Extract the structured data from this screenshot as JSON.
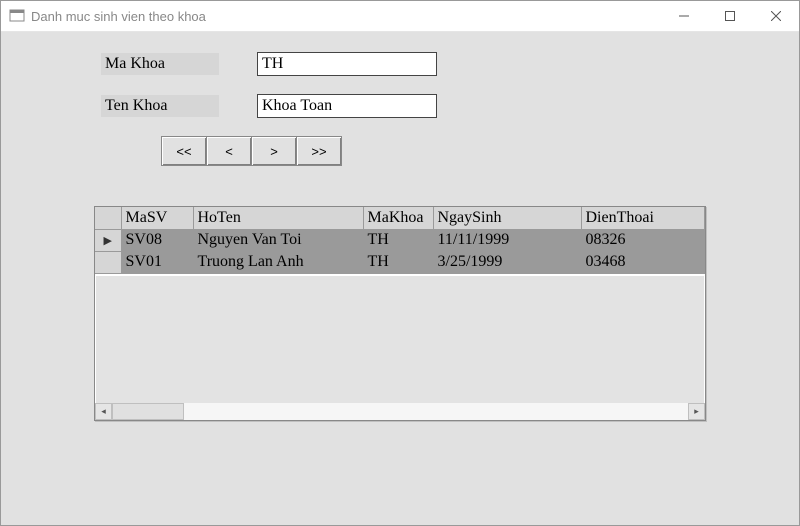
{
  "window": {
    "title": "Danh muc sinh vien theo khoa"
  },
  "form": {
    "ma_khoa_label": "Ma Khoa",
    "ma_khoa_value": "TH",
    "ten_khoa_label": "Ten Khoa",
    "ten_khoa_value": "Khoa Toan"
  },
  "nav": {
    "first": "<<",
    "prev": "<",
    "next": ">",
    "last": ">>"
  },
  "grid": {
    "columns": [
      "MaSV",
      "HoTen",
      "MaKhoa",
      "NgaySinh",
      "DienThoai"
    ],
    "rows": [
      {
        "MaSV": "SV08",
        "HoTen": "Nguyen Van Toi",
        "MaKhoa": "TH",
        "NgaySinh": "11/11/1999",
        "DienThoai": "08326"
      },
      {
        "MaSV": "SV01",
        "HoTen": "Truong Lan Anh",
        "MaKhoa": "TH",
        "NgaySinh": "3/25/1999",
        "DienThoai": "03468"
      }
    ],
    "selected_row_index": 0
  }
}
